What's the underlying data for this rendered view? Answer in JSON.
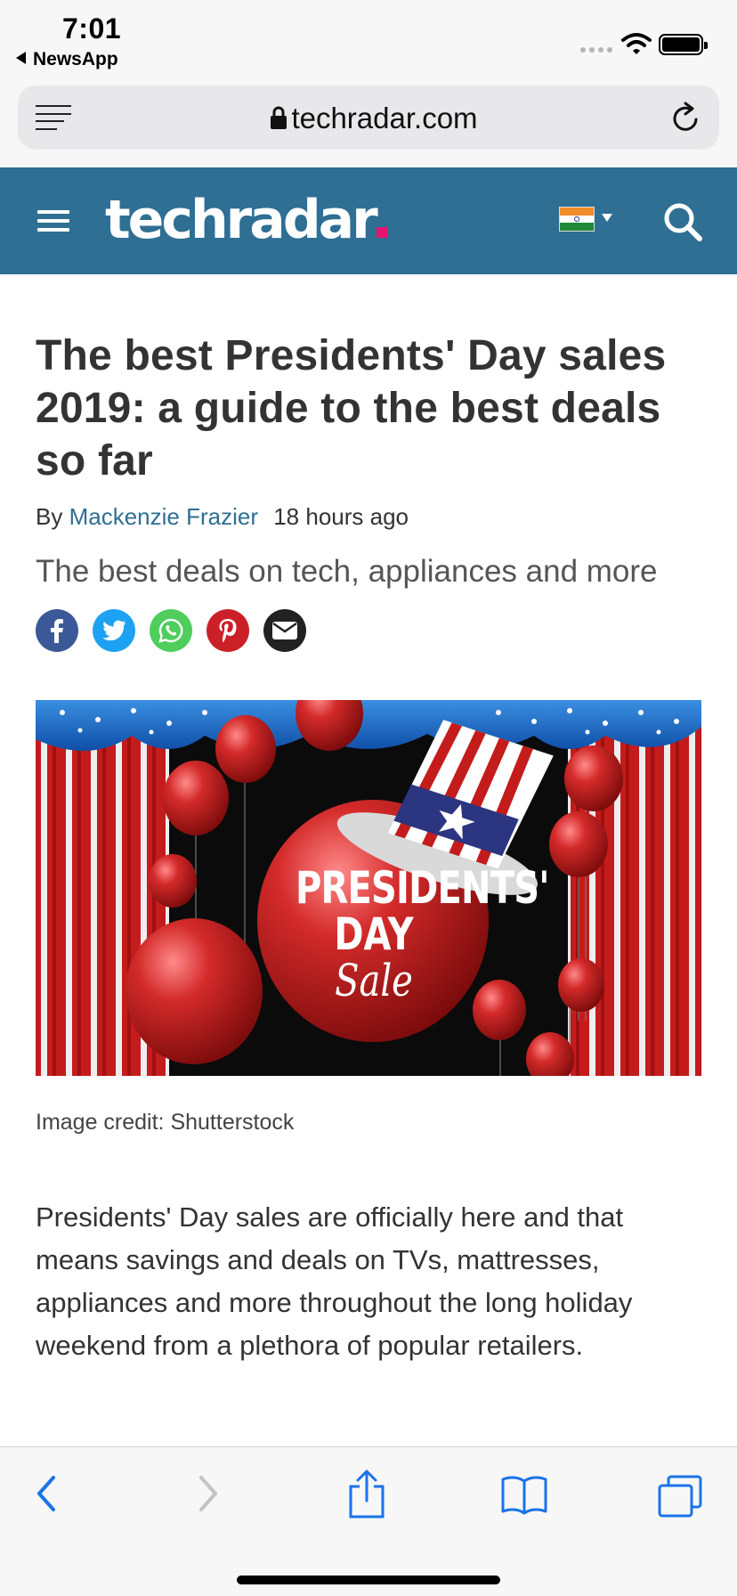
{
  "status_bar": {
    "time": "7:01",
    "back_app": "NewsApp"
  },
  "browser": {
    "url": "techradar.com",
    "nav": {
      "back": "back",
      "forward": "forward",
      "share": "share",
      "bookmarks": "bookmarks",
      "tabs": "tabs"
    }
  },
  "site": {
    "logo": "techradar",
    "region": "India",
    "colors": {
      "header": "#2f6f93",
      "logo_dot": "#e6146e",
      "link": "#2f6f93"
    }
  },
  "article": {
    "title": "The best Presidents' Day sales 2019: a guide to the best deals so far",
    "by": "By",
    "author": "Mackenzie Frazier",
    "time": "18 hours ago",
    "standfirst": "The best deals on tech, appliances and more",
    "share": [
      {
        "name": "facebook",
        "color": "#3b5998"
      },
      {
        "name": "twitter",
        "color": "#1da1f2"
      },
      {
        "name": "whatsapp",
        "color": "#4fce5d"
      },
      {
        "name": "pinterest",
        "color": "#cb2027"
      },
      {
        "name": "email",
        "color": "#222222"
      }
    ],
    "hero_text": {
      "line1": "PRESIDENTS'",
      "line2": "DAY",
      "script": "Sale"
    },
    "caption": "Image credit: Shutterstock",
    "body": "Presidents' Day sales are officially here and that means savings and deals on TVs, mattresses, appliances and more throughout the long holiday weekend from a plethora of popular retailers."
  }
}
